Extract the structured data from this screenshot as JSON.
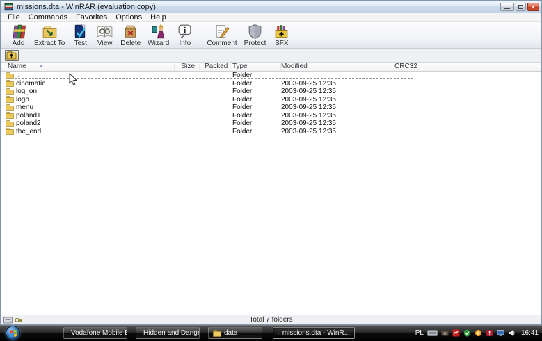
{
  "window": {
    "title": "missions.dta - WinRAR (evaluation copy)",
    "controls": {
      "close_glyph": "×"
    }
  },
  "menu": {
    "items": [
      "File",
      "Commands",
      "Favorites",
      "Options",
      "Help"
    ]
  },
  "toolbar": {
    "buttons": [
      {
        "label": "Add"
      },
      {
        "label": "Extract To"
      },
      {
        "label": "Test"
      },
      {
        "label": "View"
      },
      {
        "label": "Delete"
      },
      {
        "label": "Wizard"
      },
      {
        "label": "Info"
      },
      {
        "label": "Comment"
      },
      {
        "label": "Protect"
      },
      {
        "label": "SFX"
      }
    ]
  },
  "list": {
    "sort_glyph": "▲",
    "columns": {
      "name": "Name",
      "size": "Size",
      "packed": "Packed",
      "type": "Type",
      "modified": "Modified",
      "crc32": "CRC32"
    },
    "rows": [
      {
        "name": "..",
        "size": "",
        "packed": "",
        "type": "Folder",
        "modified": "",
        "crc32": ""
      },
      {
        "name": "cinematic",
        "size": "",
        "packed": "",
        "type": "Folder",
        "modified": "2003-09-25 12:35",
        "crc32": ""
      },
      {
        "name": "log_on",
        "size": "",
        "packed": "",
        "type": "Folder",
        "modified": "2003-09-25 12:35",
        "crc32": ""
      },
      {
        "name": "logo",
        "size": "",
        "packed": "",
        "type": "Folder",
        "modified": "2003-09-25 12:35",
        "crc32": ""
      },
      {
        "name": "menu",
        "size": "",
        "packed": "",
        "type": "Folder",
        "modified": "2003-09-25 12:35",
        "crc32": ""
      },
      {
        "name": "poland1",
        "size": "",
        "packed": "",
        "type": "Folder",
        "modified": "2003-09-25 12:35",
        "crc32": ""
      },
      {
        "name": "poland2",
        "size": "",
        "packed": "",
        "type": "Folder",
        "modified": "2003-09-25 12:35",
        "crc32": ""
      },
      {
        "name": "the_end",
        "size": "",
        "packed": "",
        "type": "Folder",
        "modified": "2003-09-25 12:35",
        "crc32": ""
      }
    ]
  },
  "status": {
    "text": "Total 7 folders"
  },
  "taskbar": {
    "buttons": [
      {
        "label": "Vodafone Mobile Br..."
      },
      {
        "label": "Hidden and Danger..."
      },
      {
        "label": "data"
      },
      {
        "label": "missions.dta - WinR..."
      }
    ],
    "tray": {
      "language": "PL",
      "clock": "16:41"
    }
  },
  "colors": {
    "folder_yellow": "#eccb5e",
    "close_button_red": "#c23a1e",
    "taskbar_black": "#000000",
    "titlebar_blue": "#cddcec"
  }
}
